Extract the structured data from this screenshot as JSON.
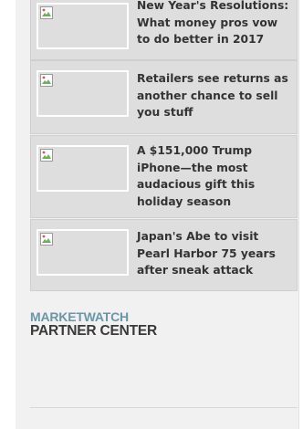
{
  "stories": [
    {
      "headline": "New Year's Resolutions: What money pros vow to do better in 2017",
      "thumb_icon": "broken-image-icon"
    },
    {
      "headline": "Retailers see returns as another chance to sell you stuff",
      "thumb_icon": "broken-image-icon"
    },
    {
      "headline": "A $151,000 Trump iPhone—the most audacious gift this holiday season",
      "thumb_icon": "broken-image-icon"
    },
    {
      "headline": "Japan's Abe to visit Pearl Harbor 75 years after sneak attack",
      "thumb_icon": "broken-image-icon"
    }
  ],
  "partner_center": {
    "brand": "MARKETWATCH",
    "title": "PARTNER CENTER"
  },
  "colors": {
    "panel_bg": "#f1f1f1",
    "card_bg": "#dedede",
    "brand_blue": "#6a96a7",
    "text_dark": "#333333"
  }
}
